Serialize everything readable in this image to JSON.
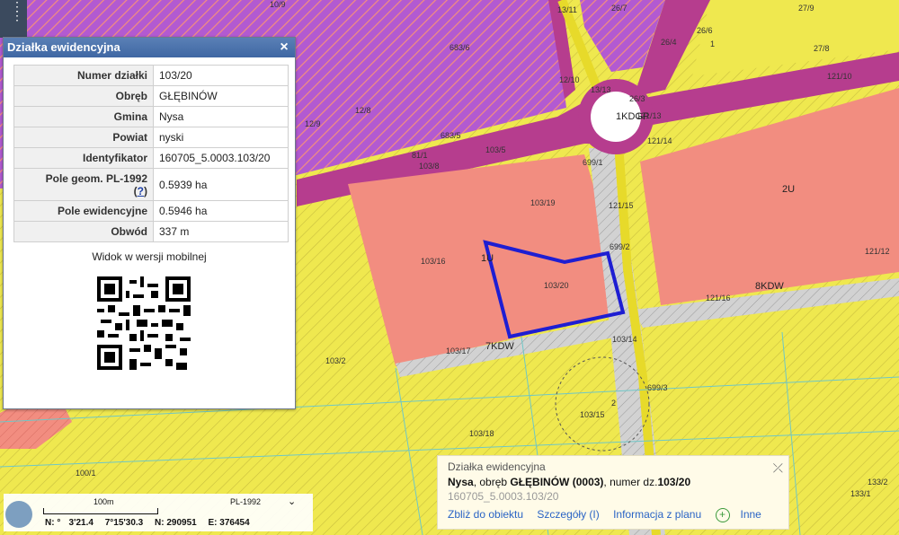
{
  "panel": {
    "title": "Działka ewidencyjna",
    "rows": [
      {
        "label": "Numer działki",
        "value": "103/20"
      },
      {
        "label": "Obręb",
        "value": "GŁĘBINÓW"
      },
      {
        "label": "Gmina",
        "value": "Nysa"
      },
      {
        "label": "Powiat",
        "value": "nyski"
      },
      {
        "label": "Identyfikator",
        "value": "160705_5.0003.103/20"
      },
      {
        "label": "Pole geom. PL-1992",
        "help": "?",
        "value": "0.5939 ha"
      },
      {
        "label": "Pole ewidencyjne",
        "value": "0.5946 ha"
      },
      {
        "label": "Obwód",
        "value": "337 m"
      }
    ],
    "mobile_title": "Widok w wersji mobilnej"
  },
  "card": {
    "title": "Działka ewidencyjna",
    "gmina": "Nysa",
    "obreb_prefix": ", obręb ",
    "obreb": "GŁĘBINÓW (0003)",
    "numer_prefix": ", numer dz.",
    "numer": "103/20",
    "identifier": "160705_5.0003.103/20",
    "links": {
      "zoom": "Zbliż do obiektu",
      "details": "Szczegóły (I)",
      "plan": "Informacja z planu",
      "more": "Inne"
    }
  },
  "scale": {
    "distance": "100m",
    "crs": "PL-1992"
  },
  "coords": {
    "lat": "N: ︎°ﾠ3'21.4",
    "lon": "7°15'30.3",
    "n": "N: 290951",
    "e": "E: 376454"
  },
  "map_labels": [
    "10/9",
    "13/11",
    "26/7",
    "26/6",
    "27/9",
    "683/6",
    "26/4",
    "1",
    "27/8",
    "12/10",
    "13/13",
    "121/10",
    "26/3",
    "1KDGP",
    "121/13",
    "12/9",
    "12/8",
    "683/5",
    "121/14",
    "81/1",
    "103/5",
    "699/1",
    "103/8",
    "103/19",
    "121/15",
    "2U",
    "1U",
    "103/16",
    "103/20",
    "699/2",
    "121/12",
    "8KDW",
    "121/16",
    "7KDW",
    "103/17",
    "103/14",
    "103/2",
    "699/3",
    "103/15",
    "2",
    "103/18",
    "100/1",
    "133/1",
    "133/2"
  ],
  "colors": {
    "parcel_outline": "#1e1ed2",
    "service_zone": "#f28d80",
    "road_zone": "#b63d8e",
    "residential_zone": "#efe84f",
    "header": "#4a72ad"
  }
}
